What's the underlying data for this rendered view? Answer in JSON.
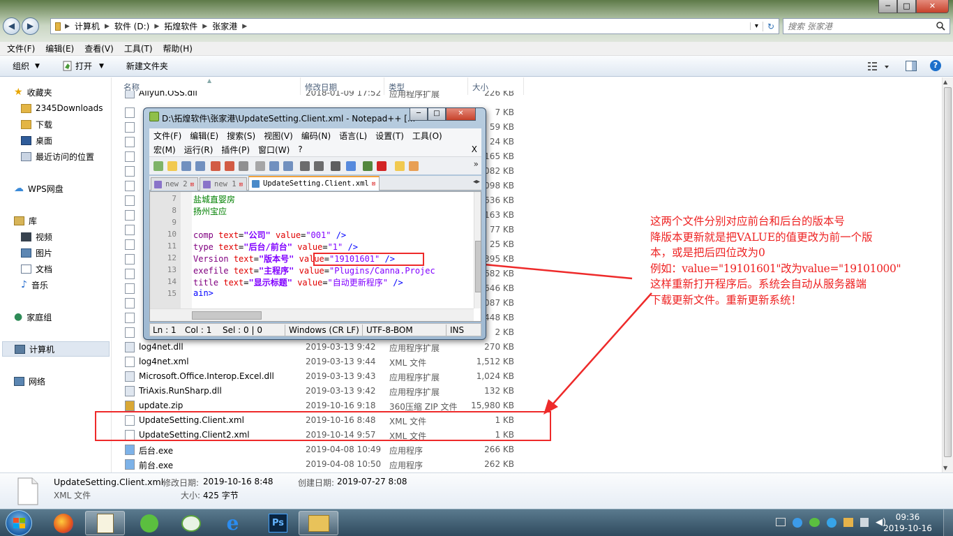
{
  "window": {
    "minimize": "─",
    "maximize": "□",
    "close": "✕"
  },
  "nav": {
    "back": "◀",
    "forward": "▶"
  },
  "address": {
    "path": [
      "计算机",
      "软件 (D:)",
      "拓煌软件",
      "张家港"
    ],
    "dropdown": "▾",
    "refresh": "↻"
  },
  "search": {
    "placeholder": "搜索 张家港"
  },
  "menu": [
    "文件(F)",
    "编辑(E)",
    "查看(V)",
    "工具(T)",
    "帮助(H)"
  ],
  "toolbar": {
    "organize": "组织",
    "open": "打开",
    "new_folder": "新建文件夹"
  },
  "sidebar": {
    "favorites": "收藏夹",
    "fav_items": [
      "2345Downloads",
      "下载",
      "桌面",
      "最近访问的位置"
    ],
    "wps": "WPS网盘",
    "libraries": "库",
    "lib_items": [
      "视频",
      "图片",
      "文档",
      "音乐"
    ],
    "homegroup": "家庭组",
    "computer": "计算机",
    "network": "网络"
  },
  "columns": {
    "name": "名称",
    "date": "修改日期",
    "type": "类型",
    "size": "大小"
  },
  "files": [
    {
      "name": "Aliyun.OSS.dll",
      "date": "2018-01-09 17:52",
      "type": "应用程序扩展",
      "size": "226 KB"
    },
    {
      "name": "",
      "date": "",
      "type": "",
      "size": "7 KB"
    },
    {
      "name": "",
      "date": "",
      "type": "",
      "size": "59 KB"
    },
    {
      "name": "",
      "date": "",
      "type": "",
      "size": "24 KB"
    },
    {
      "name": "",
      "date": "",
      "type": "",
      "size": "165 KB"
    },
    {
      "name": "",
      "date": "",
      "type": "",
      "size": "5,082 KB"
    },
    {
      "name": "",
      "date": "",
      "type": "",
      "size": "2,098 KB"
    },
    {
      "name": "",
      "date": "",
      "type": "",
      "size": "3,636 KB"
    },
    {
      "name": "",
      "date": "",
      "type": "",
      "size": "1,163 KB"
    },
    {
      "name": "",
      "date": "",
      "type": "",
      "size": "77 KB"
    },
    {
      "name": "",
      "date": "",
      "type": "",
      "size": "25 KB"
    },
    {
      "name": "",
      "date": "",
      "type": "",
      "size": "3,395 KB"
    },
    {
      "name": "",
      "date": "",
      "type": "",
      "size": "682 KB"
    },
    {
      "name": "",
      "date": "",
      "type": "",
      "size": "4,646 KB"
    },
    {
      "name": "",
      "date": "",
      "type": "",
      "size": "2,087 KB"
    },
    {
      "name": "",
      "date": "",
      "type": "",
      "size": "448 KB"
    },
    {
      "name": "",
      "date": "",
      "type": "",
      "size": "2 KB"
    },
    {
      "name": "log4net.dll",
      "date": "2019-03-13 9:42",
      "type": "应用程序扩展",
      "size": "270 KB"
    },
    {
      "name": "log4net.xml",
      "date": "2019-03-13 9:44",
      "type": "XML 文件",
      "size": "1,512 KB"
    },
    {
      "name": "Microsoft.Office.Interop.Excel.dll",
      "date": "2019-03-13 9:43",
      "type": "应用程序扩展",
      "size": "1,024 KB"
    },
    {
      "name": "TriAxis.RunSharp.dll",
      "date": "2019-03-13 9:42",
      "type": "应用程序扩展",
      "size": "132 KB"
    },
    {
      "name": "update.zip",
      "date": "2019-10-16 9:18",
      "type": "360压缩 ZIP 文件",
      "size": "15,980 KB"
    },
    {
      "name": "UpdateSetting.Client.xml",
      "date": "2019-10-16 8:48",
      "type": "XML 文件",
      "size": "1 KB"
    },
    {
      "name": "UpdateSetting.Client2.xml",
      "date": "2019-10-14 9:57",
      "type": "XML 文件",
      "size": "1 KB"
    },
    {
      "name": "后台.exe",
      "date": "2019-04-08 10:49",
      "type": "应用程序",
      "size": "266 KB"
    },
    {
      "name": "前台.exe",
      "date": "2019-04-08 10:50",
      "type": "应用程序",
      "size": "262 KB"
    }
  ],
  "details": {
    "name": "UpdateSetting.Client.xml",
    "type": "XML 文件",
    "modified_label": "修改日期:",
    "modified": "2019-10-16 8:48",
    "created_label": "创建日期:",
    "created": "2019-07-27 8:08",
    "size_label": "大小:",
    "size": "425 字节"
  },
  "notepad": {
    "title": "D:\\拓煌软件\\张家港\\UpdateSetting.Client.xml - Notepad++ [...",
    "menu1": [
      "文件(F)",
      "编辑(E)",
      "搜索(S)",
      "视图(V)",
      "编码(N)",
      "语言(L)",
      "设置(T)",
      "工具(O)"
    ],
    "menu2": [
      "宏(M)",
      "运行(R)",
      "插件(P)",
      "窗口(W)",
      "?"
    ],
    "menu_close": "X",
    "toolbar_more": "»",
    "tabs": [
      "new 2",
      "new 1",
      "UpdateSetting.Client.xml"
    ],
    "tab_close": "⊠",
    "tab_arrows": "◂▸",
    "lines": [
      {
        "n": "7",
        "text": "盐城直婴房"
      },
      {
        "n": "8",
        "text": "扬州宝应"
      },
      {
        "n": "9"
      },
      {
        "n": "10",
        "tag": "comp",
        "attr": "text",
        "val": "\"公司\"",
        "attr2": "value",
        "val2": "\"001\"",
        "end": "/>"
      },
      {
        "n": "11",
        "tag": "type",
        "attr": "text",
        "val": "\"后台/前台\"",
        "attr2": "value",
        "val2": "\"1\"",
        "end": "/>"
      },
      {
        "n": "12",
        "tag": "Version",
        "attr": "text",
        "val": "\"版本号\"",
        "attr2": "value",
        "val2": "\"19101601\"",
        "end": "/>"
      },
      {
        "n": "13",
        "tag": "exefile",
        "attr": "text",
        "val": "\"主程序\"",
        "attr2": "value",
        "val2": "\"Plugins/Canna.Projec"
      },
      {
        "n": "14",
        "tag": "title",
        "attr": "text",
        "val": "\"显示标题\"",
        "attr2": "value",
        "val2": "\"自动更新程序\"",
        "end": "/>"
      },
      {
        "n": "15",
        "text": "ain>"
      }
    ],
    "status": {
      "ln": "Ln : 1",
      "col": "Col : 1",
      "sel": "Sel : 0 | 0",
      "eol": "Windows (CR LF)",
      "enc": "UTF-8-BOM",
      "ins": "INS"
    }
  },
  "annotation": [
    "这两个文件分别对应前台和后台的版本号",
    "降版本更新就是把VALUE的值更改为前一个版",
    "本，或是把后四位改为0",
    "例如：value=\"19101601\"改为value=\"19101000\"",
    "这样重新打开程序后。系统会自动从服务器端",
    "下载更新文件。重新更新系统！"
  ],
  "taskbar": {
    "time": "09:36",
    "date": "2019-10-16"
  },
  "colors": {
    "annotation": "#ee2222",
    "notepad_frame": "#a9c2da",
    "taskbar": "#3f5e72"
  }
}
